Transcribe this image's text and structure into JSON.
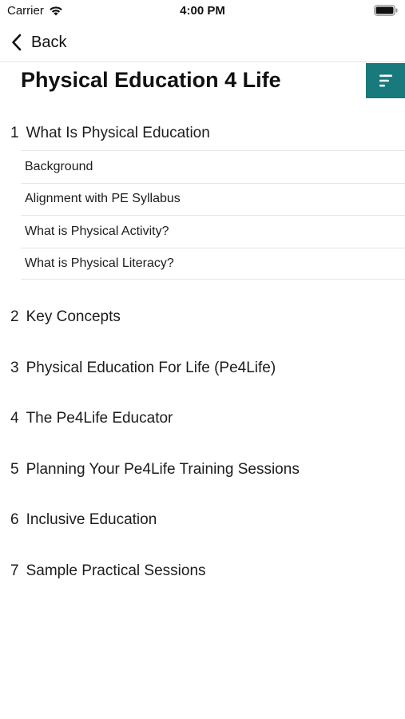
{
  "status_bar": {
    "carrier": "Carrier",
    "time": "4:00 PM"
  },
  "nav": {
    "back_label": "Back"
  },
  "header": {
    "title": "Physical Education 4 Life",
    "menu_button_color": "#187a7c"
  },
  "toc": {
    "chapters": [
      {
        "number": "1",
        "title": "What Is Physical Education",
        "subsections": [
          "Background",
          "Alignment with PE Syllabus",
          "What is Physical Activity?",
          "What is Physical Literacy?"
        ]
      },
      {
        "number": "2",
        "title": "Key Concepts"
      },
      {
        "number": "3",
        "title": "Physical Education For Life (Pe4Life)"
      },
      {
        "number": "4",
        "title": "The Pe4Life Educator"
      },
      {
        "number": "5",
        "title": "Planning Your Pe4Life Training Sessions"
      },
      {
        "number": "6",
        "title": "Inclusive Education"
      },
      {
        "number": "7",
        "title": "Sample Practical Sessions"
      }
    ]
  }
}
